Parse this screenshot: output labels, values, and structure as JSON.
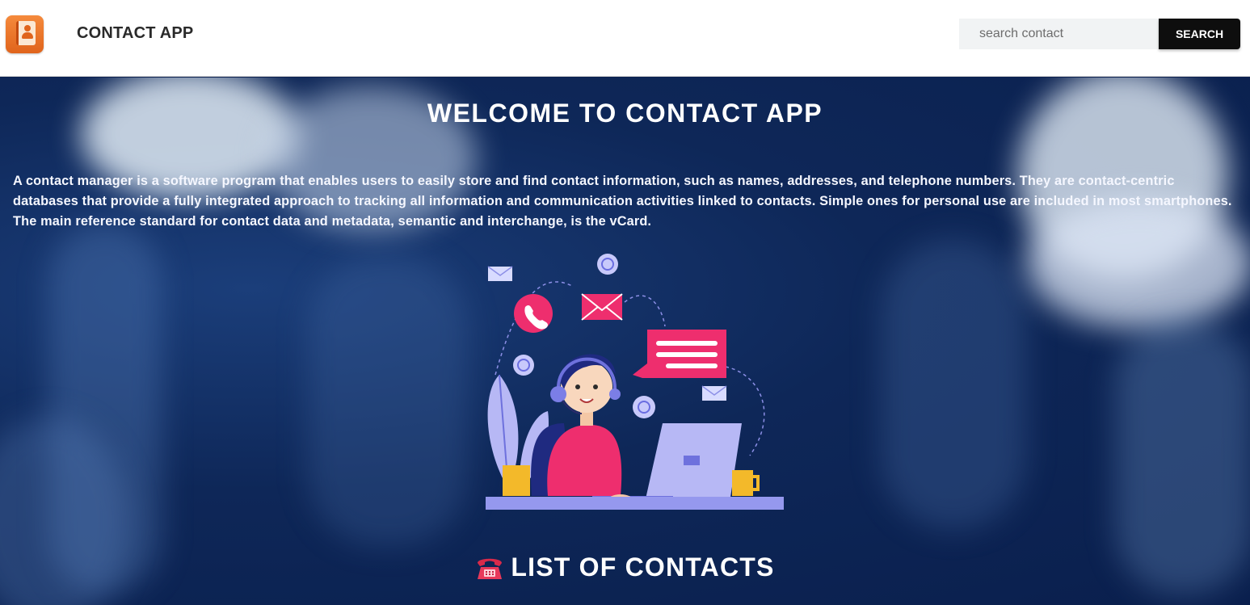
{
  "navbar": {
    "app_title": "CONTACT APP",
    "search": {
      "placeholder": "search contact",
      "value": ""
    },
    "search_button_label": "SEARCH"
  },
  "hero": {
    "title": "WELCOME TO CONTACT APP",
    "description": "A contact manager is a software program that enables users to easily store and find contact information, such as names, addresses, and telephone numbers. They are contact-centric databases that provide a fully integrated approach to tracking all information and communication activities linked to contacts. Simple ones for personal use are included in most smartphones. The main reference standard for contact data and metadata, semantic and interchange, is the vCard."
  },
  "contacts_section": {
    "heading": "LIST OF CONTACTS",
    "icon": "telephone-icon"
  },
  "colors": {
    "navbar_bg": "#ffffff",
    "hero_bg": "#0c2150",
    "button_bg": "#0e0e0e",
    "accent_pink": "#ee2e6e",
    "accent_lavender": "#a9aaf0"
  }
}
